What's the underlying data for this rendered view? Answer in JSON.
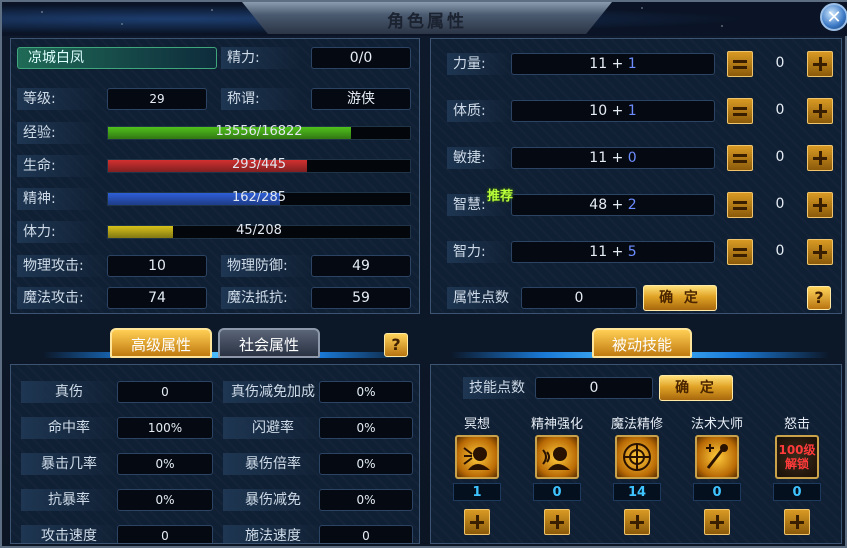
{
  "window": {
    "title": "角色属性",
    "close_label": "✕"
  },
  "basic": {
    "name": "凉城白凤",
    "energy_label": "精力:",
    "energy_value": "0/0",
    "level_label": "等级:",
    "level_value": "29",
    "title_label": "称谓:",
    "title_value": "游侠",
    "exp_label": "经验:",
    "exp_text": "13556/16822",
    "exp_ratio": 0.806,
    "hp_label": "生命:",
    "hp_text": "293/445",
    "hp_ratio": 0.658,
    "mp_label": "精神:",
    "mp_text": "162/285",
    "mp_ratio": 0.568,
    "stamina_label": "体力:",
    "stamina_text": "45/208",
    "stamina_ratio": 0.216,
    "phys_atk_label": "物理攻击:",
    "phys_atk_value": "10",
    "phys_def_label": "物理防御:",
    "phys_def_value": "49",
    "mag_atk_label": "魔法攻击:",
    "mag_atk_value": "74",
    "mag_res_label": "魔法抵抗:",
    "mag_res_value": "59"
  },
  "tabs": {
    "advanced": "高级属性",
    "social": "社会属性",
    "help": "?"
  },
  "advanced": [
    {
      "label": "真伤",
      "value": "0",
      "label2": "真伤减免加成",
      "value2": "0%"
    },
    {
      "label": "命中率",
      "value": "100%",
      "label2": "闪避率",
      "value2": "0%"
    },
    {
      "label": "暴击几率",
      "value": "0%",
      "label2": "暴伤倍率",
      "value2": "0%"
    },
    {
      "label": "抗暴率",
      "value": "0%",
      "label2": "暴伤减免",
      "value2": "0%"
    },
    {
      "label": "攻击速度",
      "value": "0",
      "label2": "施法速度",
      "value2": "0"
    }
  ],
  "attributes": [
    {
      "label": "力量:",
      "base": "11",
      "bonus": "1",
      "points": "0"
    },
    {
      "label": "体质:",
      "base": "10",
      "bonus": "1",
      "points": "0"
    },
    {
      "label": "敏捷:",
      "base": "11",
      "bonus": "0",
      "points": "0"
    },
    {
      "label": "智慧:",
      "base": "48",
      "bonus": "2",
      "points": "0"
    },
    {
      "label": "智力:",
      "base": "11",
      "bonus": "5",
      "points": "0"
    }
  ],
  "recommend_label": "推荐",
  "attr_points": {
    "label": "属性点数",
    "value": "0",
    "confirm": "确 定",
    "help": "?"
  },
  "passive": {
    "tab": "被动技能",
    "points_label": "技能点数",
    "points_value": "0",
    "confirm": "确 定",
    "skills": [
      {
        "name": "冥想",
        "count": "1",
        "icon": "meditation-icon"
      },
      {
        "name": "精神强化",
        "count": "0",
        "icon": "spirit-icon"
      },
      {
        "name": "魔法精修",
        "count": "14",
        "icon": "magic-icon"
      },
      {
        "name": "法术大师",
        "count": "0",
        "icon": "spell-master-icon"
      },
      {
        "name": "怒击",
        "count": "0",
        "icon": "locked-icon",
        "locked_text": "100级解锁"
      }
    ]
  },
  "colors": {
    "exp": "#4fc21a",
    "hp": "#d23030",
    "mp": "#2f5fd8",
    "stamina": "#d6c21a",
    "accent": "#e0a325"
  }
}
